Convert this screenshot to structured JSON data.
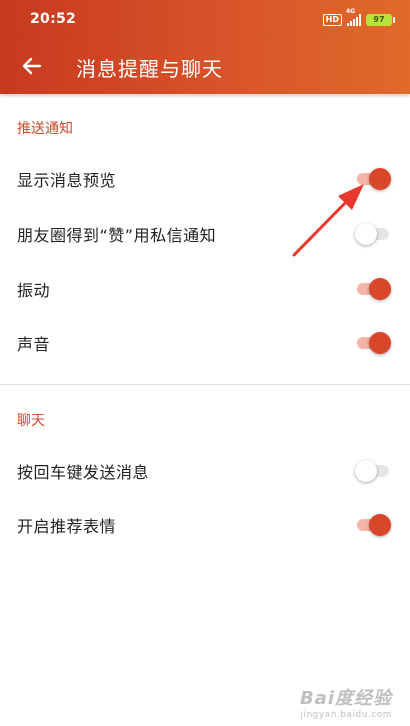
{
  "status_bar": {
    "time": "20:52",
    "hd": "HD",
    "network": "4G",
    "battery": "97"
  },
  "app_bar": {
    "back_icon": "arrow-left-icon",
    "title": "消息提醒与聊天"
  },
  "sections": [
    {
      "header": "推送通知",
      "rows": [
        {
          "label": "显示消息预览",
          "on": true
        },
        {
          "label": "朋友圈得到“赞”用私信通知",
          "on": false
        },
        {
          "label": "振动",
          "on": true
        },
        {
          "label": "声音",
          "on": true
        }
      ]
    },
    {
      "header": "聊天",
      "rows": [
        {
          "label": "按回车键发送消息",
          "on": false
        },
        {
          "label": "开启推荐表情",
          "on": true
        }
      ]
    }
  ],
  "annotation_arrow": {
    "color": "#e8372c"
  },
  "watermark": {
    "main": "Bai度经验",
    "sub": "jingyan.baidu.com"
  },
  "colors": {
    "accent": "#d9472b",
    "header_gradient_start": "#c8391f",
    "header_gradient_end": "#e06a2a",
    "section_header": "#d04a2a"
  }
}
